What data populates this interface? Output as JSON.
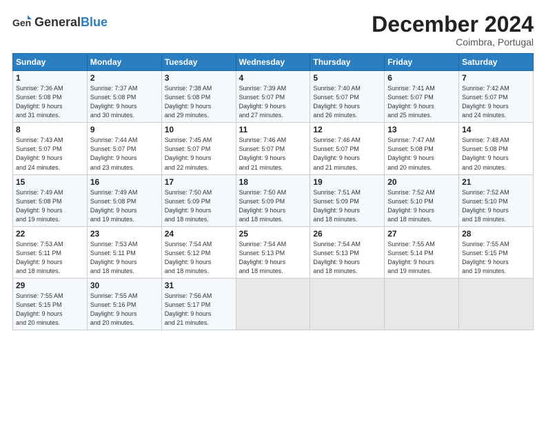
{
  "header": {
    "logo_general": "General",
    "logo_blue": "Blue",
    "month_title": "December 2024",
    "location": "Coimbra, Portugal"
  },
  "weekdays": [
    "Sunday",
    "Monday",
    "Tuesday",
    "Wednesday",
    "Thursday",
    "Friday",
    "Saturday"
  ],
  "weeks": [
    [
      {
        "day": "1",
        "info": "Sunrise: 7:36 AM\nSunset: 5:08 PM\nDaylight: 9 hours\nand 31 minutes."
      },
      {
        "day": "2",
        "info": "Sunrise: 7:37 AM\nSunset: 5:08 PM\nDaylight: 9 hours\nand 30 minutes."
      },
      {
        "day": "3",
        "info": "Sunrise: 7:38 AM\nSunset: 5:08 PM\nDaylight: 9 hours\nand 29 minutes."
      },
      {
        "day": "4",
        "info": "Sunrise: 7:39 AM\nSunset: 5:07 PM\nDaylight: 9 hours\nand 27 minutes."
      },
      {
        "day": "5",
        "info": "Sunrise: 7:40 AM\nSunset: 5:07 PM\nDaylight: 9 hours\nand 26 minutes."
      },
      {
        "day": "6",
        "info": "Sunrise: 7:41 AM\nSunset: 5:07 PM\nDaylight: 9 hours\nand 25 minutes."
      },
      {
        "day": "7",
        "info": "Sunrise: 7:42 AM\nSunset: 5:07 PM\nDaylight: 9 hours\nand 24 minutes."
      }
    ],
    [
      {
        "day": "8",
        "info": "Sunrise: 7:43 AM\nSunset: 5:07 PM\nDaylight: 9 hours\nand 24 minutes."
      },
      {
        "day": "9",
        "info": "Sunrise: 7:44 AM\nSunset: 5:07 PM\nDaylight: 9 hours\nand 23 minutes."
      },
      {
        "day": "10",
        "info": "Sunrise: 7:45 AM\nSunset: 5:07 PM\nDaylight: 9 hours\nand 22 minutes."
      },
      {
        "day": "11",
        "info": "Sunrise: 7:46 AM\nSunset: 5:07 PM\nDaylight: 9 hours\nand 21 minutes."
      },
      {
        "day": "12",
        "info": "Sunrise: 7:46 AM\nSunset: 5:07 PM\nDaylight: 9 hours\nand 21 minutes."
      },
      {
        "day": "13",
        "info": "Sunrise: 7:47 AM\nSunset: 5:08 PM\nDaylight: 9 hours\nand 20 minutes."
      },
      {
        "day": "14",
        "info": "Sunrise: 7:48 AM\nSunset: 5:08 PM\nDaylight: 9 hours\nand 20 minutes."
      }
    ],
    [
      {
        "day": "15",
        "info": "Sunrise: 7:49 AM\nSunset: 5:08 PM\nDaylight: 9 hours\nand 19 minutes."
      },
      {
        "day": "16",
        "info": "Sunrise: 7:49 AM\nSunset: 5:08 PM\nDaylight: 9 hours\nand 19 minutes."
      },
      {
        "day": "17",
        "info": "Sunrise: 7:50 AM\nSunset: 5:09 PM\nDaylight: 9 hours\nand 18 minutes."
      },
      {
        "day": "18",
        "info": "Sunrise: 7:50 AM\nSunset: 5:09 PM\nDaylight: 9 hours\nand 18 minutes."
      },
      {
        "day": "19",
        "info": "Sunrise: 7:51 AM\nSunset: 5:09 PM\nDaylight: 9 hours\nand 18 minutes."
      },
      {
        "day": "20",
        "info": "Sunrise: 7:52 AM\nSunset: 5:10 PM\nDaylight: 9 hours\nand 18 minutes."
      },
      {
        "day": "21",
        "info": "Sunrise: 7:52 AM\nSunset: 5:10 PM\nDaylight: 9 hours\nand 18 minutes."
      }
    ],
    [
      {
        "day": "22",
        "info": "Sunrise: 7:53 AM\nSunset: 5:11 PM\nDaylight: 9 hours\nand 18 minutes."
      },
      {
        "day": "23",
        "info": "Sunrise: 7:53 AM\nSunset: 5:11 PM\nDaylight: 9 hours\nand 18 minutes."
      },
      {
        "day": "24",
        "info": "Sunrise: 7:54 AM\nSunset: 5:12 PM\nDaylight: 9 hours\nand 18 minutes."
      },
      {
        "day": "25",
        "info": "Sunrise: 7:54 AM\nSunset: 5:13 PM\nDaylight: 9 hours\nand 18 minutes."
      },
      {
        "day": "26",
        "info": "Sunrise: 7:54 AM\nSunset: 5:13 PM\nDaylight: 9 hours\nand 18 minutes."
      },
      {
        "day": "27",
        "info": "Sunrise: 7:55 AM\nSunset: 5:14 PM\nDaylight: 9 hours\nand 19 minutes."
      },
      {
        "day": "28",
        "info": "Sunrise: 7:55 AM\nSunset: 5:15 PM\nDaylight: 9 hours\nand 19 minutes."
      }
    ],
    [
      {
        "day": "29",
        "info": "Sunrise: 7:55 AM\nSunset: 5:15 PM\nDaylight: 9 hours\nand 20 minutes."
      },
      {
        "day": "30",
        "info": "Sunrise: 7:55 AM\nSunset: 5:16 PM\nDaylight: 9 hours\nand 20 minutes."
      },
      {
        "day": "31",
        "info": "Sunrise: 7:56 AM\nSunset: 5:17 PM\nDaylight: 9 hours\nand 21 minutes."
      },
      {
        "day": "",
        "info": ""
      },
      {
        "day": "",
        "info": ""
      },
      {
        "day": "",
        "info": ""
      },
      {
        "day": "",
        "info": ""
      }
    ]
  ]
}
